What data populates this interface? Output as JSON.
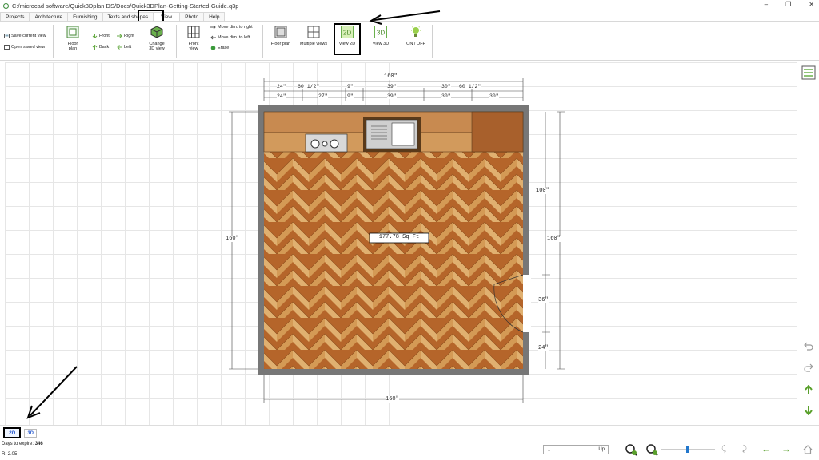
{
  "window": {
    "title": "C:/microcad software/Quick3Dplan DS/Docs/Quick3DPlan-Getting-Started-Guide.q3p",
    "minimize": "–",
    "restore": "❐",
    "close": "✕"
  },
  "tabs": [
    "Projects",
    "Architecture",
    "Furnishing",
    "Texts and shapes",
    "View",
    "Photo",
    "Help"
  ],
  "ribbon": {
    "save_current_view": "Save current view",
    "open_saved_view": "Open saved view",
    "floor_plan_view": "Floor plan",
    "front": "Front",
    "back": "Back",
    "right": "Right",
    "left": "Left",
    "change_3d_view": "Change 3D view",
    "front_view": "Front view",
    "move_dim_right": "Move dim. to right",
    "move_dim_left": "Move dim. to left",
    "erase": "Erase",
    "floor_plan": "Floor plan",
    "multiple_views": "Multiple views",
    "view_2d": "View 2D",
    "view_3d": "View 3D",
    "on_off": "ON / OFF"
  },
  "plan": {
    "area": "177.78 Sq Ft",
    "dim_top_total": "160\"",
    "dim_top_row1": [
      "24\"",
      "60 1/2\"",
      "9\"",
      "39\"",
      "30\"",
      "60 1/2\""
    ],
    "dim_top_row2": [
      "24\"",
      "27\"",
      "9\"",
      "39\"",
      "30\"",
      "30\""
    ],
    "dim_left": "160\"",
    "dim_right_outer": "160\"",
    "dim_right_inner": [
      "100\"",
      "36\"",
      "24\""
    ],
    "dim_bottom": "160\""
  },
  "bottom": {
    "btn_2d": "2D",
    "btn_3d": "3D",
    "days_label": "Days to expire:",
    "days_value": "346",
    "r_label": "R: 2.05",
    "direction": "Up"
  },
  "colors": {
    "highlight": "#000000",
    "green_icon": "#5aa02c",
    "floor_dark": "#b5652a",
    "floor_light": "#e0b070"
  }
}
